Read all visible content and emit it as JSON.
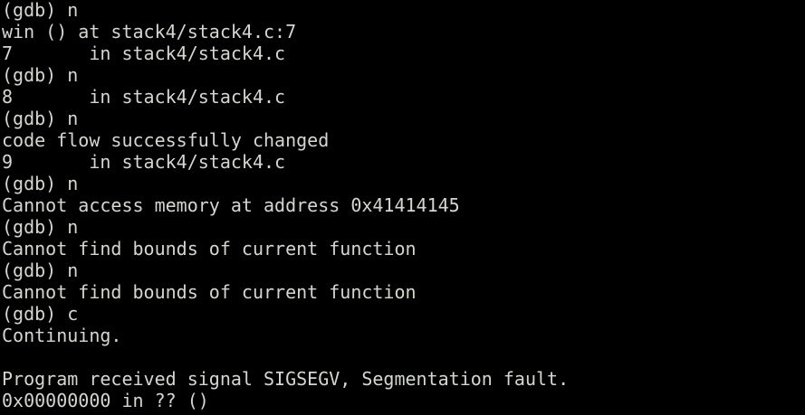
{
  "terminal": {
    "lines": [
      "(gdb) n",
      "win () at stack4/stack4.c:7",
      "7       in stack4/stack4.c",
      "(gdb) n",
      "8       in stack4/stack4.c",
      "(gdb) n",
      "code flow successfully changed",
      "9       in stack4/stack4.c",
      "(gdb) n",
      "Cannot access memory at address 0x41414145",
      "(gdb) n",
      "Cannot find bounds of current function",
      "(gdb) n",
      "Cannot find bounds of current function",
      "(gdb) c",
      "Continuing.",
      "",
      "Program received signal SIGSEGV, Segmentation fault.",
      "0x00000000 in ?? ()"
    ],
    "colors": {
      "background": "#000000",
      "foreground": "#d3d7cf"
    }
  }
}
